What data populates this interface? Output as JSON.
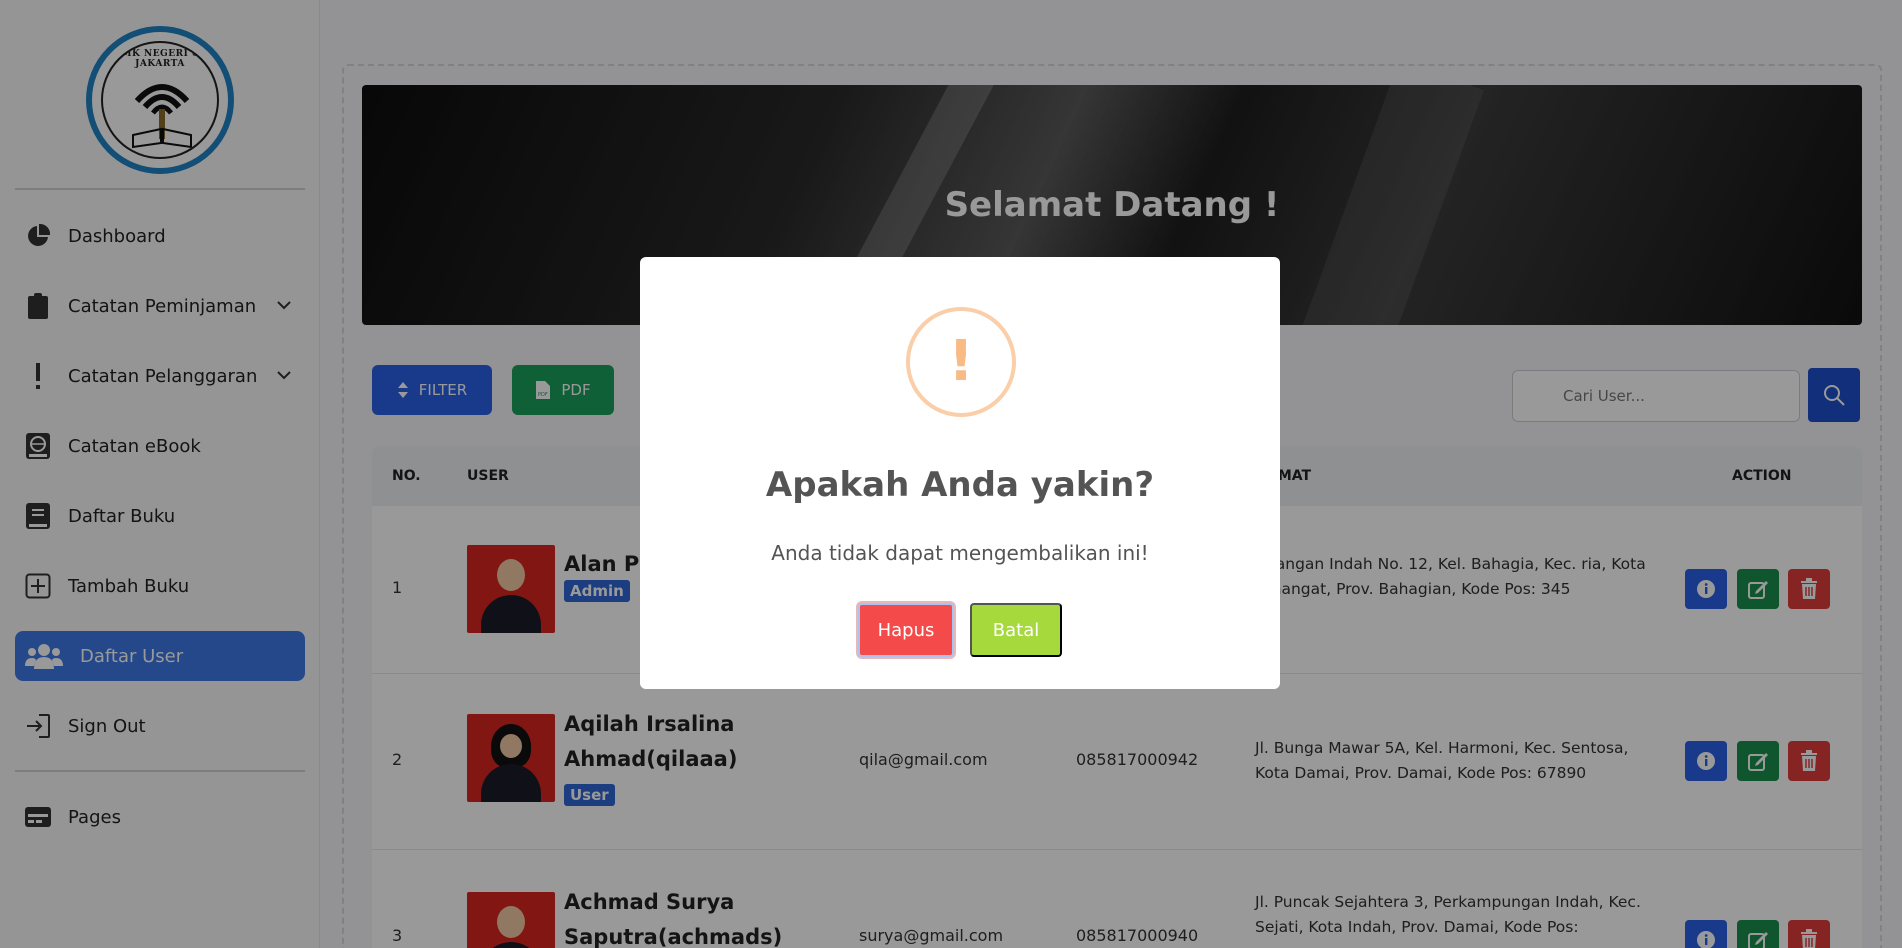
{
  "logo": {
    "text": "SMK NEGERI 65 JAKARTA"
  },
  "sidebar": {
    "items": [
      {
        "label": "Dashboard",
        "icon": "pie-chart-icon"
      },
      {
        "label": "Catatan Peminjaman",
        "icon": "clipboard-icon",
        "has_submenu": true
      },
      {
        "label": "Catatan Pelanggaran",
        "icon": "exclamation-icon",
        "has_submenu": true
      },
      {
        "label": "Catatan eBook",
        "icon": "globe-book-icon"
      },
      {
        "label": "Daftar Buku",
        "icon": "book-icon"
      },
      {
        "label": "Tambah Buku",
        "icon": "plus-square-icon"
      },
      {
        "label": "Daftar User",
        "icon": "users-icon",
        "active": true
      },
      {
        "label": "Sign Out",
        "icon": "sign-out-icon"
      },
      {
        "label": "Pages",
        "icon": "pages-icon"
      }
    ]
  },
  "banner": {
    "title": "Selamat Datang !"
  },
  "toolbar": {
    "filter_label": "FILTER",
    "pdf_label": "PDF"
  },
  "search": {
    "placeholder": "Cari User..."
  },
  "table": {
    "headers": {
      "no": "NO.",
      "user": "USER",
      "alamat": "AMAT",
      "action": "ACTION"
    },
    "rows": [
      {
        "no": "1",
        "name_line1": "Alan Pra",
        "name_line2": "",
        "role": "Admin",
        "email": "",
        "phone": "",
        "address": "Kenangan Indah No. 12, Kel. Bahagia, Kec. ria, Kota Semangat, Prov. Bahagian, Kode Pos: 345"
      },
      {
        "no": "2",
        "name_line1": "Aqilah Irsalina",
        "name_line2": "Ahmad(qilaaa)",
        "role": "User",
        "email": "qila@gmail.com",
        "phone": "085817000942",
        "address": "Jl. Bunga Mawar 5A, Kel. Harmoni, Kec. Sentosa, Kota Damai, Prov. Damai, Kode Pos: 67890"
      },
      {
        "no": "3",
        "name_line1": "Achmad Surya",
        "name_line2": "Saputra(achmads)",
        "role": "",
        "email": "surya@gmail.com",
        "phone": "085817000940",
        "address": "Jl. Puncak Sejahtera 3, Perkampungan Indah, Kec. Sejati, Kota Indah, Prov. Damai, Kode Pos:"
      }
    ]
  },
  "modal": {
    "icon": "warning-icon",
    "title": "Apakah Anda yakin?",
    "text": "Anda tidak dapat mengembalikan ini!",
    "confirm_label": "Hapus",
    "cancel_label": "Batal"
  },
  "colors": {
    "primary": "#2a62e6",
    "success": "#1a9e5c",
    "danger": "#e03c3c",
    "sidebar_active": "#3c78e6",
    "confirm": "#f44a4a",
    "cancel": "#a6d93c",
    "warning": "#f8bb86"
  }
}
